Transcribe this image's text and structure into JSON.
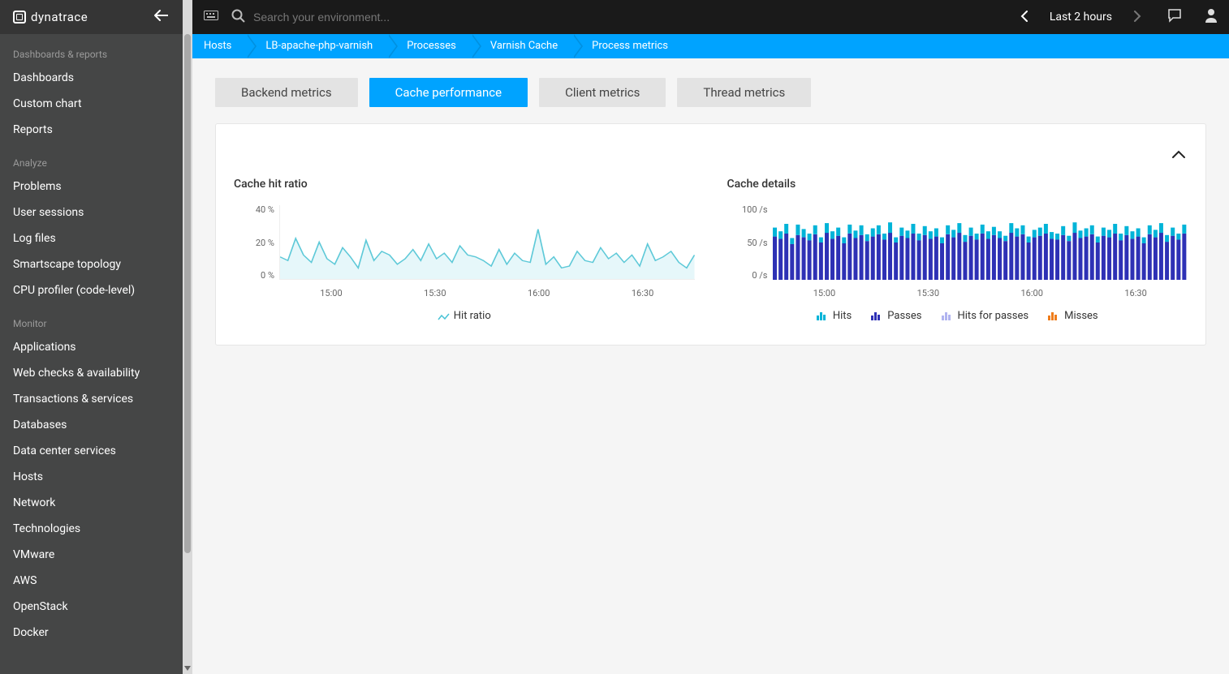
{
  "brand": "dynatrace",
  "search": {
    "placeholder": "Search your environment..."
  },
  "timeframe": {
    "label": "Last 2 hours"
  },
  "sidebar": {
    "sections": [
      {
        "label": "Dashboards & reports",
        "items": [
          "Dashboards",
          "Custom chart",
          "Reports"
        ]
      },
      {
        "label": "Analyze",
        "items": [
          "Problems",
          "User sessions",
          "Log files",
          "Smartscape topology",
          "CPU profiler (code-level)"
        ]
      },
      {
        "label": "Monitor",
        "items": [
          "Applications",
          "Web checks & availability",
          "Transactions & services",
          "Databases",
          "Data center services",
          "Hosts",
          "Network",
          "Technologies",
          "VMware",
          "AWS",
          "OpenStack",
          "Docker"
        ]
      }
    ]
  },
  "breadcrumb": [
    "Hosts",
    "LB-apache-php-varnish",
    "Processes",
    "Varnish Cache",
    "Process metrics"
  ],
  "tabs": [
    "Backend metrics",
    "Cache performance",
    "Client metrics",
    "Thread metrics"
  ],
  "activeTab": 1,
  "chart_data": [
    {
      "type": "line",
      "title": "Cache hit ratio",
      "ylabel": "%",
      "ylim": [
        0,
        40
      ],
      "yticks": [
        "40 %",
        "20 %",
        "0 %"
      ],
      "xticks": [
        "15:00",
        "15:30",
        "16:00",
        "16:30"
      ],
      "legend": [
        "Hit ratio"
      ],
      "series": [
        {
          "name": "Hit ratio",
          "color": "#5ec9d8",
          "values": [
            12,
            10,
            22,
            13,
            9,
            20,
            11,
            8,
            17,
            12,
            6,
            21,
            10,
            15,
            13,
            8,
            11,
            16,
            10,
            19,
            11,
            14,
            9,
            18,
            13,
            12,
            10,
            7,
            16,
            8,
            14,
            10,
            9,
            27,
            8,
            12,
            6,
            7,
            15,
            10,
            9,
            17,
            11,
            14,
            9,
            13,
            7,
            19,
            10,
            12,
            15,
            9,
            6,
            13
          ]
        }
      ]
    },
    {
      "type": "bar",
      "title": "Cache details",
      "ylabel": "/s",
      "ylim": [
        0,
        100
      ],
      "yticks": [
        "100 /s",
        "50 /s",
        "0 /s"
      ],
      "xticks": [
        "15:00",
        "15:30",
        "16:00",
        "16:30"
      ],
      "legend": [
        "Hits",
        "Passes",
        "Hits for passes",
        "Misses"
      ],
      "colors": {
        "Hits": "#00b4d8",
        "Passes": "#2e31b5",
        "Hits for passes": "#b1b4f0",
        "Misses": "#ef7c1a"
      },
      "categories_count": 72,
      "series": [
        {
          "name": "Passes",
          "color": "#2e31b5",
          "values": [
            58,
            55,
            62,
            48,
            60,
            57,
            53,
            61,
            50,
            63,
            55,
            59,
            49,
            62,
            56,
            60,
            52,
            58,
            61,
            54,
            63,
            50,
            59,
            56,
            62,
            53,
            60,
            55,
            58,
            49,
            61,
            57,
            63,
            51,
            59,
            54,
            62,
            55,
            60,
            56,
            52,
            63,
            58,
            61,
            50,
            57,
            59,
            62,
            55,
            54,
            60,
            52,
            63,
            56,
            58,
            61,
            50,
            59,
            57,
            62,
            53,
            60,
            55,
            58,
            49,
            61,
            57,
            63,
            51,
            59,
            54,
            62
          ]
        },
        {
          "name": "Hits",
          "color": "#00b4d8",
          "values": [
            12,
            10,
            13,
            8,
            14,
            11,
            9,
            12,
            7,
            13,
            10,
            11,
            8,
            12,
            10,
            13,
            9,
            11,
            12,
            8,
            14,
            7,
            11,
            10,
            13,
            9,
            12,
            10,
            11,
            8,
            12,
            10,
            13,
            9,
            11,
            8,
            12,
            10,
            11,
            9,
            7,
            13,
            11,
            12,
            8,
            10,
            11,
            13,
            9,
            8,
            12,
            7,
            14,
            10,
            11,
            12,
            8,
            11,
            10,
            13,
            9,
            12,
            10,
            11,
            8,
            12,
            10,
            13,
            9,
            11,
            8,
            12
          ]
        }
      ]
    }
  ]
}
